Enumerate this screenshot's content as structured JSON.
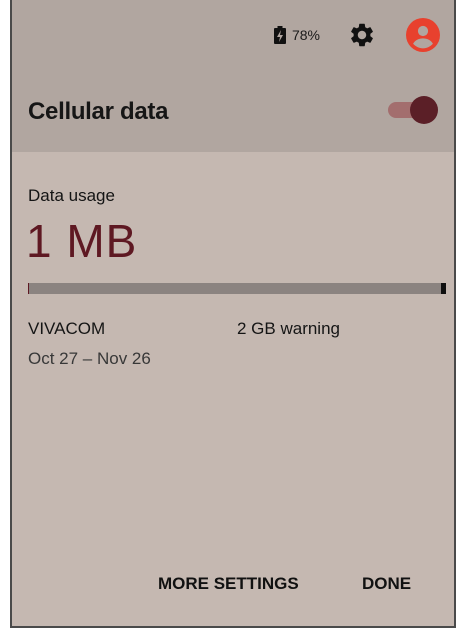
{
  "status_bar": {
    "battery_percent": "78%",
    "battery_icon": "battery-charging-icon",
    "settings_icon": "gear-icon",
    "account_icon": "account-circle-icon",
    "account_icon_color": "#e8412e"
  },
  "panel": {
    "title": "Cellular data",
    "toggle_on": true,
    "accent_color": "#5e1822"
  },
  "usage": {
    "label": "Data usage",
    "value": "1 MB",
    "progress_fraction": 0.0005
  },
  "plan": {
    "carrier": "VIVACOM",
    "warning": "2 GB warning",
    "period": "Oct 27 – Nov 26"
  },
  "actions": {
    "more_settings": "MORE SETTINGS",
    "done": "DONE"
  }
}
